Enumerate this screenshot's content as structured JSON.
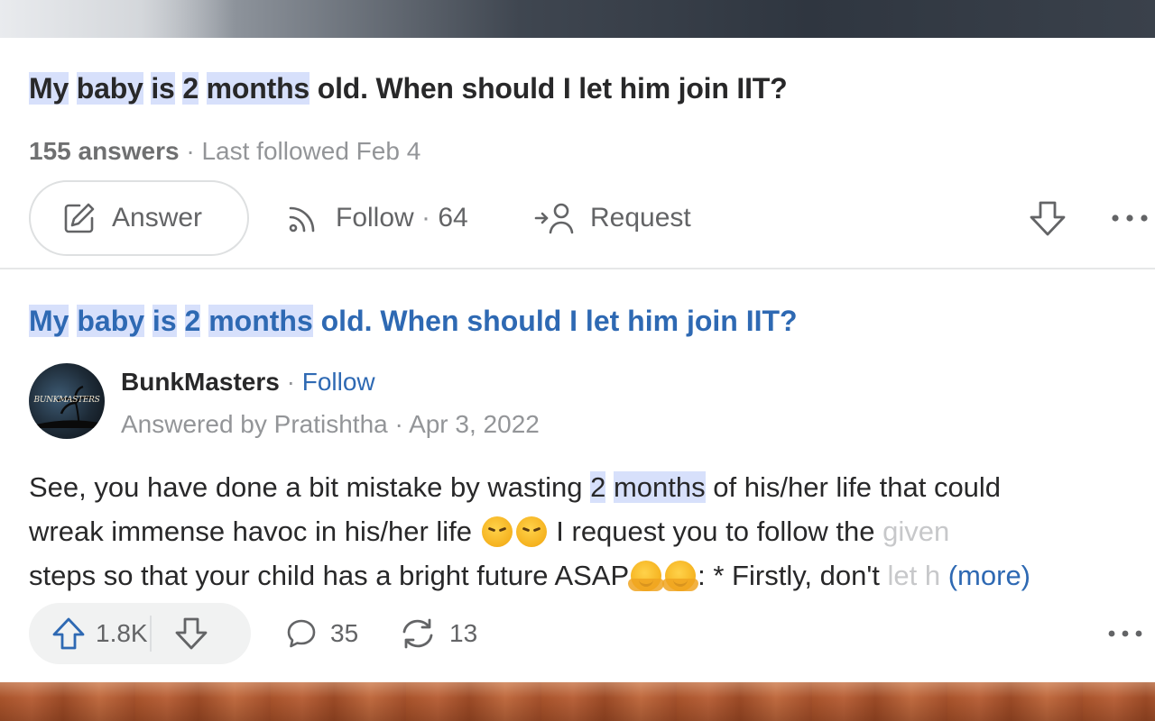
{
  "question": {
    "title_parts": [
      "My",
      " ",
      "baby",
      " ",
      "is",
      " ",
      "2",
      " ",
      "months",
      " old. When should I let him join IIT?"
    ],
    "answers_count": "155 answers",
    "meta_sep": " · ",
    "last_followed": "Last followed Feb 4",
    "actions": {
      "answer_label": "Answer",
      "follow_label": "Follow",
      "follow_sep": " · ",
      "follow_count": "64",
      "request_label": "Request"
    }
  },
  "answer": {
    "title_parts": [
      "My",
      " ",
      "baby",
      " ",
      "is",
      " ",
      "2",
      " ",
      "months",
      " old. When should I let him join IIT?"
    ],
    "author": "BunkMasters",
    "author_sep": " · ",
    "follow_label": "Follow",
    "answered_by": "Answered by Pratishtha",
    "date_sep": " · ",
    "date": "Apr 3, 2022",
    "avatar_text": "BUNKMASTERS",
    "body": {
      "l1_a": "See, you have done a bit mistake by wasting ",
      "l1_hl1": "2",
      "l1_sp": " ",
      "l1_hl2": "months",
      "l1_b": " of his/her life that could",
      "l2_a": "wreak immense havoc in his/her life ",
      "l2_b": " I request you to follow the ",
      "l2_fade": "given",
      "l3_a": "steps so that your child has a bright future ASAP",
      "l3_b": ": * Firstly, don't ",
      "l3_fade": "let h",
      "more": "(more)"
    },
    "stats": {
      "upvotes": "1.8K",
      "comments": "35",
      "shares": "13"
    }
  },
  "colors": {
    "link": "#2e69b3",
    "highlight": "#d7e0fb",
    "muted": "#939598"
  },
  "icons": {
    "answer": "pencil-square-icon",
    "follow": "rss-feed-icon",
    "request": "add-person-icon",
    "downvote": "arrow-down-icon",
    "more": "ellipsis-icon",
    "upvote": "arrow-up-icon",
    "comment": "comment-bubble-icon",
    "share": "share-cycle-icon"
  }
}
